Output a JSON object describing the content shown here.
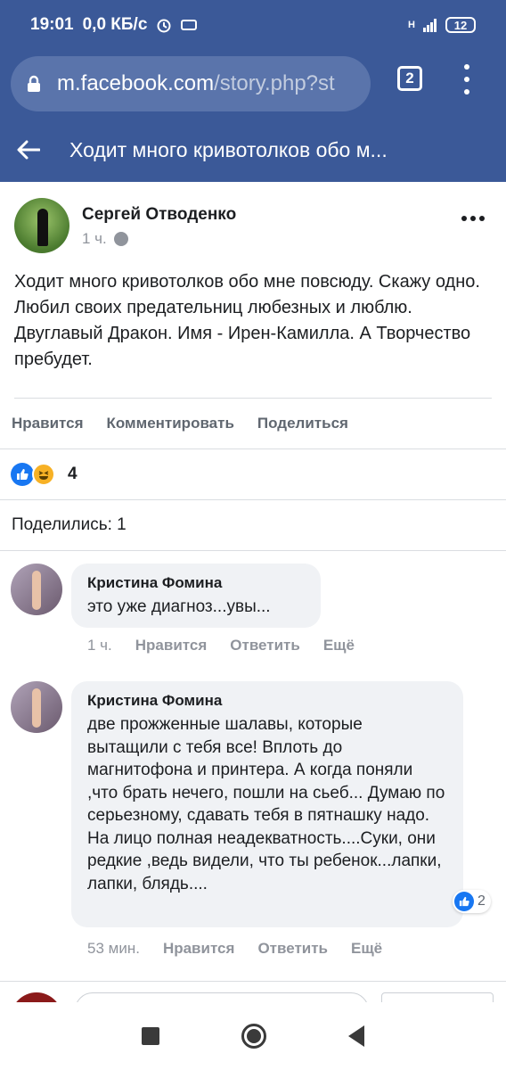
{
  "status_bar": {
    "time": "19:01",
    "speed": "0,0 КБ/с",
    "network": "H",
    "battery": "12"
  },
  "browser": {
    "url_host": "m.facebook.com",
    "url_path": "/story.php?st",
    "tab_count": "2"
  },
  "app_bar": {
    "title": "Ходит много кривотолков обо м..."
  },
  "post": {
    "author": "Сергей Отводенко",
    "time": "1 ч.",
    "text": "Ходит много кривотолков обо мне повсюду. Скажу одно. Любил своих предательниц любезных и люблю. Двуглавый Дракон. Имя - Ирен-Камилла. А Творчество пребудет.",
    "actions": {
      "like": "Нравится",
      "comment": "Комментировать",
      "share": "Поделиться"
    },
    "reactions_count": "4",
    "shares_label": "Поделились: 1"
  },
  "comments": [
    {
      "name": "Кристина Фомина",
      "text": "это уже диагноз...увы...",
      "time": "1 ч.",
      "like": "Нравится",
      "reply": "Ответить",
      "more": "Ещё"
    },
    {
      "name": "Кристина Фомина",
      "text": "две прожженные шалавы, которые вытащили с тебя все! Вплоть до магнитофона и принтера. А когда поняли ,что брать нечего, пошли на сьеб... Думаю по серьезному, сдавать тебя в пятнашку надо. На лицо полная неадекватность....Суки, они редкие ,ведь видели, что ты ребенок...лапки, лапки, блядь....",
      "time": "53 мин.",
      "like": "Нравится",
      "reply": "Ответить",
      "more": "Ещё",
      "reaction_count": "2"
    }
  ],
  "colors": {
    "brand": "#3b5998",
    "like": "#1877f2",
    "muted": "#90949c"
  },
  "icons": [
    "lock-icon",
    "back-arrow-icon",
    "globe-icon",
    "more-icon",
    "like-icon",
    "haha-icon",
    "recent-apps-icon",
    "home-icon",
    "back-icon"
  ]
}
